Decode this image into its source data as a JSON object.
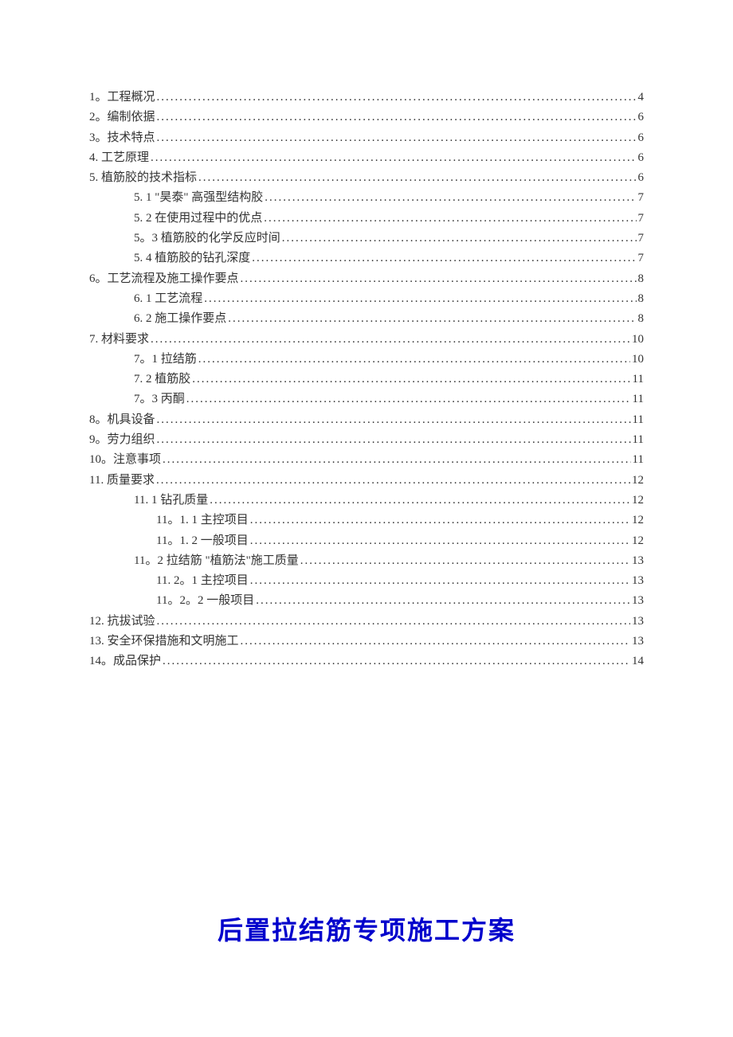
{
  "toc": [
    {
      "level": 1,
      "label": "1。工程概况",
      "page": "4"
    },
    {
      "level": 1,
      "label": "2。编制依据",
      "page": "6"
    },
    {
      "level": 1,
      "label": "3。技术特点",
      "page": "6"
    },
    {
      "level": 1,
      "label": "4. 工艺原理",
      "page": "6"
    },
    {
      "level": 1,
      "label": "5. 植筋胶的技术指标",
      "page": "6"
    },
    {
      "level": 2,
      "label": "5. 1 \"昊泰\" 高强型结构胶",
      "page": "7"
    },
    {
      "level": 2,
      "label": "5. 2 在使用过程中的优点",
      "page": "7"
    },
    {
      "level": 2,
      "label": "5。3 植筋胶的化学反应时间",
      "page": "7"
    },
    {
      "level": 2,
      "label": "5. 4 植筋胶的钻孔深度",
      "page": "7"
    },
    {
      "level": 1,
      "label": "6。工艺流程及施工操作要点",
      "page": "8"
    },
    {
      "level": 2,
      "label": "6. 1 工艺流程",
      "page": "8"
    },
    {
      "level": 2,
      "label": "6. 2 施工操作要点",
      "page": "8"
    },
    {
      "level": 1,
      "label": "7. 材料要求",
      "page": "10"
    },
    {
      "level": 2,
      "label": "7。1 拉结筋",
      "page": "10"
    },
    {
      "level": 2,
      "label": "7. 2 植筋胶",
      "page": "11"
    },
    {
      "level": 2,
      "label": "7。3 丙酮",
      "page": "11"
    },
    {
      "level": 1,
      "label": "8。机具设备",
      "page": "11"
    },
    {
      "level": 1,
      "label": "9。劳力组织",
      "page": "11"
    },
    {
      "level": 1,
      "label": "10。注意事项",
      "page": "11"
    },
    {
      "level": 1,
      "label": "11. 质量要求",
      "page": "12"
    },
    {
      "level": 2,
      "label": "11. 1 钻孔质量",
      "page": "12"
    },
    {
      "level": 3,
      "label": "11。1. 1 主控项目",
      "page": "12"
    },
    {
      "level": 3,
      "label": "11。1. 2 一般项目",
      "page": "12"
    },
    {
      "level": 2,
      "label": "11。2 拉结筋 \"植筋法\"施工质量",
      "page": "13"
    },
    {
      "level": 3,
      "label": "11. 2。1 主控项目",
      "page": "13"
    },
    {
      "level": 3,
      "label": "11。2。2 一般项目",
      "page": "13"
    },
    {
      "level": 1,
      "label": "12. 抗拔试验",
      "page": "13"
    },
    {
      "level": 1,
      "label": "13. 安全环保措施和文明施工",
      "page": "13"
    },
    {
      "level": 1,
      "label": "14。成品保护",
      "page": "14"
    }
  ],
  "title": "后置拉结筋专项施工方案"
}
